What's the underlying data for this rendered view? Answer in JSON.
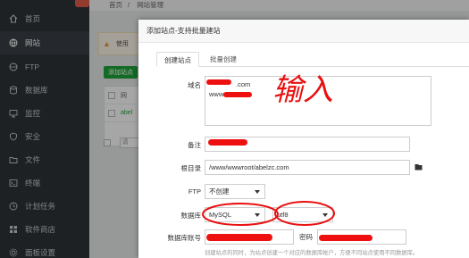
{
  "sidebar": {
    "items": [
      {
        "label": "首页",
        "icon": "home-icon"
      },
      {
        "label": "网站",
        "icon": "globe-icon",
        "active": true
      },
      {
        "label": "FTP",
        "icon": "ftp-icon"
      },
      {
        "label": "数据库",
        "icon": "database-icon"
      },
      {
        "label": "监控",
        "icon": "monitor-icon"
      },
      {
        "label": "安全",
        "icon": "shield-icon"
      },
      {
        "label": "文件",
        "icon": "folder-icon"
      },
      {
        "label": "终端",
        "icon": "terminal-icon"
      },
      {
        "label": "计划任务",
        "icon": "clock-icon"
      },
      {
        "label": "软件商店",
        "icon": "store-icon"
      },
      {
        "label": "面板设置",
        "icon": "gear-icon"
      }
    ]
  },
  "breadcrumb": {
    "home": "首页",
    "separator": "/",
    "current": "网站管理"
  },
  "background": {
    "warning_text": "使用",
    "add_site_button": "添加站点",
    "table_header_label": "网",
    "row_site": "abel",
    "search_placeholder": "请"
  },
  "modal": {
    "title": "添加站点-支持批量建站",
    "tabs": [
      {
        "label": "创建站点",
        "active": true
      },
      {
        "label": "批量创建",
        "active": false
      }
    ],
    "domain": {
      "label": "域名",
      "value_lines": [
        ".com",
        "www.        .com"
      ]
    },
    "note": {
      "label": "备注",
      "value": ""
    },
    "root_dir": {
      "label": "根目录",
      "value": "/www/wwwroot/abelzc.com"
    },
    "ftp": {
      "label": "FTP",
      "value": "不创建"
    },
    "database": {
      "label": "数据库",
      "value": "MySQL",
      "charset": "utf8"
    },
    "db_account": {
      "label": "数据库账号",
      "value": "",
      "password_label": "密码",
      "password_value": ""
    },
    "hint": "创建站点的同时，为站点创建一个对应的数据库帐户，方便不同站点使用不同数据库。",
    "annotation": "输入"
  },
  "colors": {
    "accent_green": "#20a53a",
    "sidebar_bg": "#2f3438",
    "ink_red": "#e81010"
  }
}
